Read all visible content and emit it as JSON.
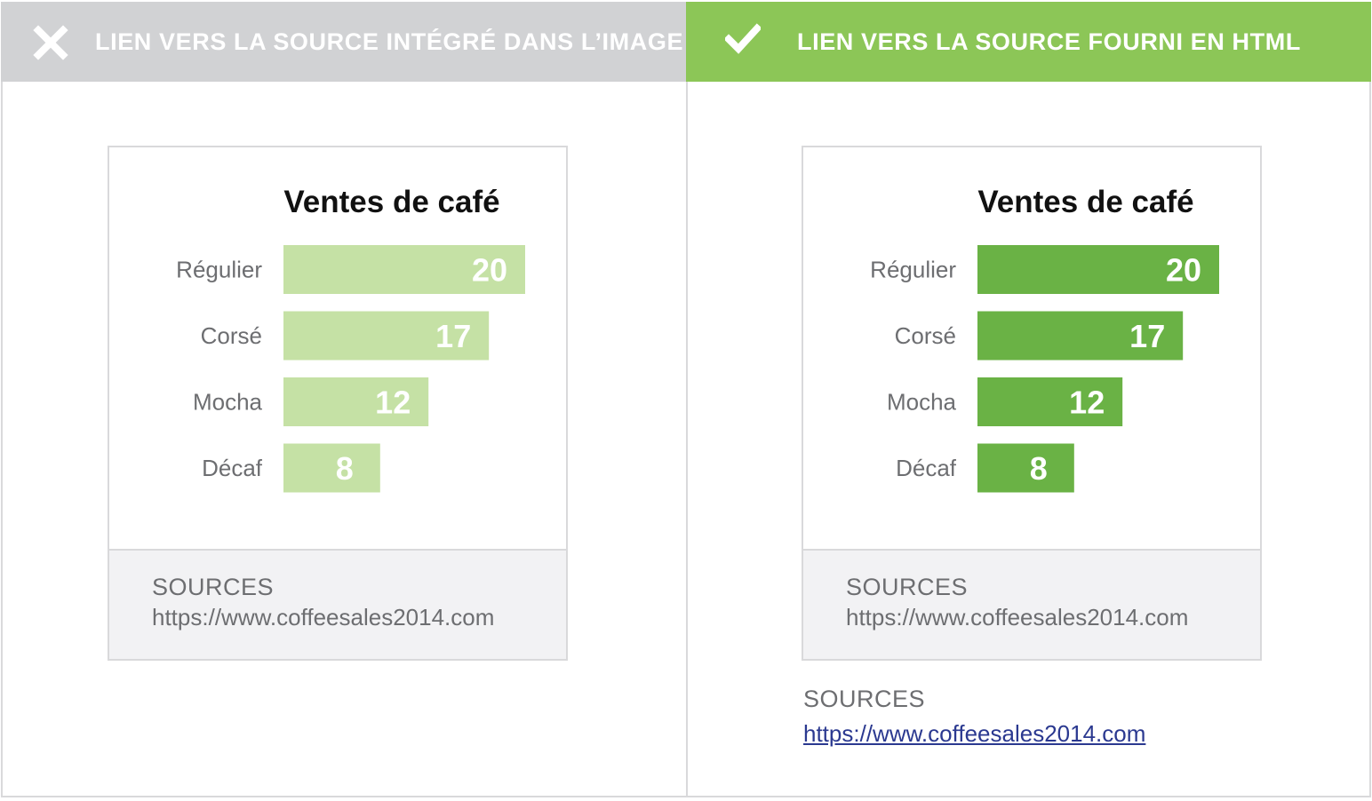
{
  "left_panel": {
    "banner_text": "LIEN VERS LA SOURCE INTÉGRÉ DANS L’IMAGE",
    "banner_icon": "close-icon",
    "banner_color": "#d1d2d4",
    "bar_color": "#c5e1a5",
    "footer": {
      "heading": "SOURCES",
      "url": "https://www.coffeesales2014.com"
    }
  },
  "right_panel": {
    "banner_text": "LIEN VERS LA SOURCE FOURNI EN HTML",
    "banner_icon": "checkmark-icon",
    "banner_color": "#8cc657",
    "bar_color": "#6ab245",
    "footer": {
      "heading": "SOURCES",
      "url": "https://www.coffeesales2014.com"
    },
    "html_source": {
      "heading": "SOURCES",
      "link": "https://www.coffeesales2014.com"
    }
  },
  "chart_data": [
    {
      "type": "bar",
      "orientation": "horizontal",
      "title": "Ventes de café",
      "categories": [
        "Régulier",
        "Corsé",
        "Mocha",
        "Décaf"
      ],
      "values": [
        20,
        17,
        12,
        8
      ],
      "data_labels": true,
      "grid": false,
      "legend": false,
      "xlim": [
        0,
        20
      ],
      "color": "#c5e1a5"
    },
    {
      "type": "bar",
      "orientation": "horizontal",
      "title": "Ventes de café",
      "categories": [
        "Régulier",
        "Corsé",
        "Mocha",
        "Décaf"
      ],
      "values": [
        20,
        17,
        12,
        8
      ],
      "data_labels": true,
      "grid": false,
      "legend": false,
      "xlim": [
        0,
        20
      ],
      "color": "#6ab245"
    }
  ]
}
